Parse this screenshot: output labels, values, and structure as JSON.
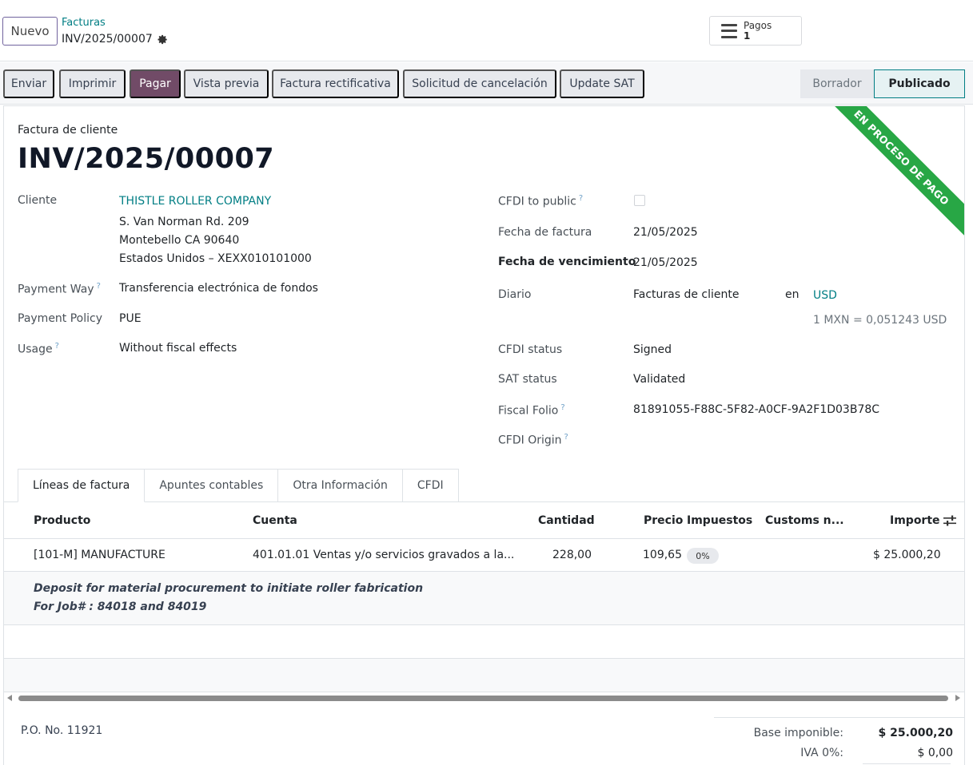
{
  "control_panel": {
    "new_button": "Nuevo",
    "breadcrumb_parent": "Facturas",
    "breadcrumb_current": "INV/2025/00007",
    "smart_button": {
      "label": "Pagos",
      "value": "1"
    }
  },
  "statusbar": {
    "actions": [
      "Enviar",
      "Imprimir",
      "Pagar",
      "Vista previa",
      "Factura rectificativa",
      "Solicitud de cancelación",
      "Update SAT"
    ],
    "states": [
      "Borrador",
      "Publicado"
    ],
    "active_state": "Publicado"
  },
  "sheet": {
    "ribbon": "EN PROCESO DE PAGO",
    "doc_type": "Factura de cliente",
    "title": "INV/2025/00007",
    "left": {
      "cliente_label": "Cliente",
      "cliente_name": "THISTLE ROLLER COMPANY",
      "address_1": "S. Van Norman Rd. 209",
      "address_2": "Montebello CA 90640",
      "address_3": "Estados Unidos – XEXX010101000",
      "payment_way_label": "Payment Way",
      "payment_way": "Transferencia electrónica de fondos",
      "payment_policy_label": "Payment Policy",
      "payment_policy": "PUE",
      "usage_label": "Usage",
      "usage": "Without fiscal effects"
    },
    "right": {
      "cfdi_public_label": "CFDI to public",
      "fecha_factura_label": "Fecha de factura",
      "fecha_factura": "21/05/2025",
      "fecha_venc_label": "Fecha de vencimiento",
      "fecha_venc": "21/05/2025",
      "diario_label": "Diario",
      "diario": "Facturas de cliente",
      "en": "en",
      "currency": "USD",
      "rate": "1 MXN = 0,051243 USD",
      "cfdi_status_label": "CFDI status",
      "cfdi_status": "Signed",
      "sat_status_label": "SAT status",
      "sat_status": "Validated",
      "fiscal_folio_label": "Fiscal Folio",
      "fiscal_folio": "81891055-F88C-5F82-A0CF-9A2F1D03B78C",
      "cfdi_origin_label": "CFDI Origin",
      "help_mark": "?"
    },
    "tabs": [
      "Líneas de factura",
      "Apuntes contables",
      "Otra Información",
      "CFDI"
    ],
    "table": {
      "headers": {
        "producto": "Producto",
        "cuenta": "Cuenta",
        "cantidad": "Cantidad",
        "precio": "Precio",
        "impuestos": "Impuestos",
        "customs": "Customs n...",
        "importe": "Importe"
      },
      "row": {
        "producto": "[101-M] MANUFACTURE",
        "cuenta": "401.01.01 Ventas y/o servicios gravados a la...",
        "cantidad": "228,00",
        "precio": "109,65",
        "impuesto": "0%",
        "importe": "$ 25.000,20"
      },
      "note_1": "Deposit for material procurement to initiate roller fabrication",
      "note_2": "For Job# : 84018 and 84019"
    },
    "po": "P.O. No. 11921",
    "totals": {
      "base_label": "Base imponible:",
      "base_value": "$ 25.000,20",
      "iva_label": "IVA 0%:",
      "iva_value": "$ 0,00"
    }
  },
  "colors": {
    "primary": "#714b67",
    "link": "#017e84",
    "ribbon": "#28a745"
  }
}
